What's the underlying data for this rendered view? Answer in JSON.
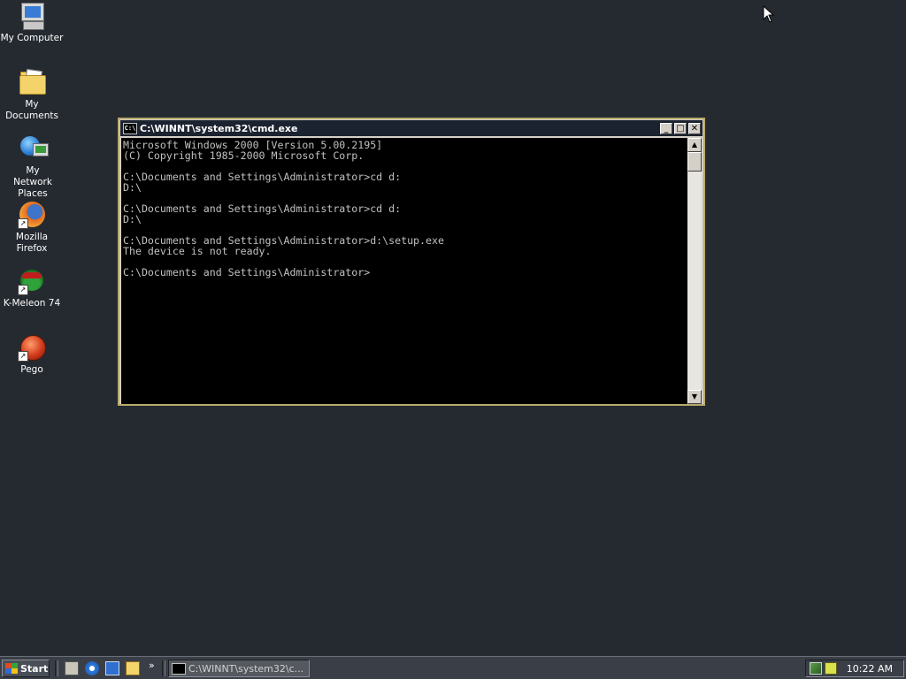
{
  "desktop": {
    "icons": [
      {
        "label": "My Computer",
        "icon": "my-computer-icon"
      },
      {
        "label": "My Documents",
        "icon": "my-documents-icon"
      },
      {
        "label": "My Network Places",
        "icon": "network-places-icon"
      },
      {
        "label": "Mozilla Firefox",
        "icon": "firefox-icon"
      },
      {
        "label": "K-Meleon 74",
        "icon": "k-meleon-icon"
      },
      {
        "label": "Pego",
        "icon": "pego-icon"
      }
    ],
    "background_color": "#252a31"
  },
  "window": {
    "title": "C:\\WINNT\\system32\\cmd.exe",
    "title_icon_text": "C:\\",
    "buttons": {
      "minimize": "_",
      "maximize": "□",
      "close": "✕"
    },
    "console_lines": [
      "Microsoft Windows 2000 [Version 5.00.2195]",
      "(C) Copyright 1985-2000 Microsoft Corp.",
      "",
      "C:\\Documents and Settings\\Administrator>cd d:",
      "D:\\",
      "",
      "C:\\Documents and Settings\\Administrator>cd d:",
      "D:\\",
      "",
      "C:\\Documents and Settings\\Administrator>d:\\setup.exe",
      "The device is not ready.",
      "",
      "C:\\Documents and Settings\\Administrator>"
    ],
    "scroll_up": "▲",
    "scroll_down": "▼"
  },
  "taskbar": {
    "start_label": "Start",
    "quick_launch": [
      "show-desktop-icon",
      "internet-explorer-icon",
      "outlook-express-icon",
      "search-icon"
    ],
    "more_label": "»",
    "task_button_label": "C:\\WINNT\\system32\\c...",
    "clock": "10:22 AM"
  },
  "colors": {
    "window_border": "#b9a96a",
    "titlebar": "#1c2330",
    "console_bg": "#000000",
    "console_text": "#c0c0c0",
    "taskbar": "#3a3f47"
  }
}
